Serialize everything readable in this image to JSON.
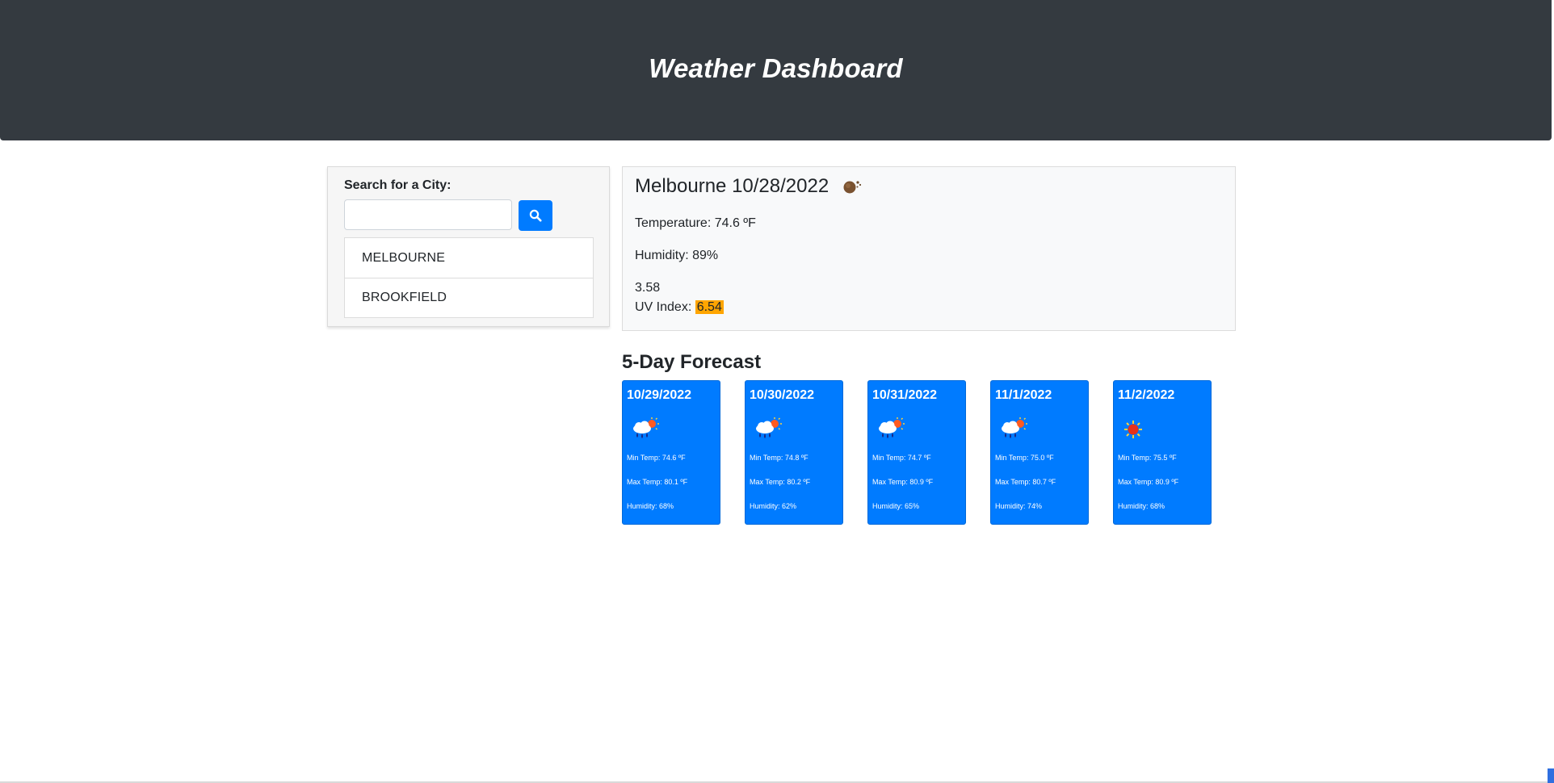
{
  "header": {
    "title": "Weather Dashboard"
  },
  "search": {
    "label": "Search for a City:",
    "input_value": "",
    "placeholder": "",
    "button_icon": "search-icon",
    "history": [
      "MELBOURNE",
      "BROOKFIELD"
    ]
  },
  "current": {
    "title": "Melbourne 10/28/2022",
    "icon": "cloud-night-icon",
    "temperature": "Temperature: 74.6 ºF",
    "humidity": "Humidity: 89%",
    "wind": "3.58",
    "uv_label": "UV Index: ",
    "uv_value": "6.54",
    "uv_color": "#ffa500"
  },
  "forecast": {
    "title": "5-Day Forecast",
    "days": [
      {
        "date": "10/29/2022",
        "icon": "rain-sun-icon",
        "min": "Min Temp: 74.6 ºF",
        "max": "Max Temp: 80.1 ºF",
        "humidity": "Humidity: 68%"
      },
      {
        "date": "10/30/2022",
        "icon": "rain-sun-icon",
        "min": "Min Temp: 74.8 ºF",
        "max": "Max Temp: 80.2 ºF",
        "humidity": "Humidity: 62%"
      },
      {
        "date": "10/31/2022",
        "icon": "rain-sun-icon",
        "min": "Min Temp: 74.7 ºF",
        "max": "Max Temp: 80.9 ºF",
        "humidity": "Humidity: 65%"
      },
      {
        "date": "11/1/2022",
        "icon": "rain-sun-icon",
        "min": "Min Temp: 75.0 ºF",
        "max": "Max Temp: 80.7 ºF",
        "humidity": "Humidity: 74%"
      },
      {
        "date": "11/2/2022",
        "icon": "sun-icon",
        "min": "Min Temp: 75.5 ºF",
        "max": "Max Temp: 80.9 ºF",
        "humidity": "Humidity: 68%"
      }
    ]
  },
  "colors": {
    "header_bg": "#343a40",
    "primary": "#007bff",
    "uv_moderate": "#ffa500"
  }
}
